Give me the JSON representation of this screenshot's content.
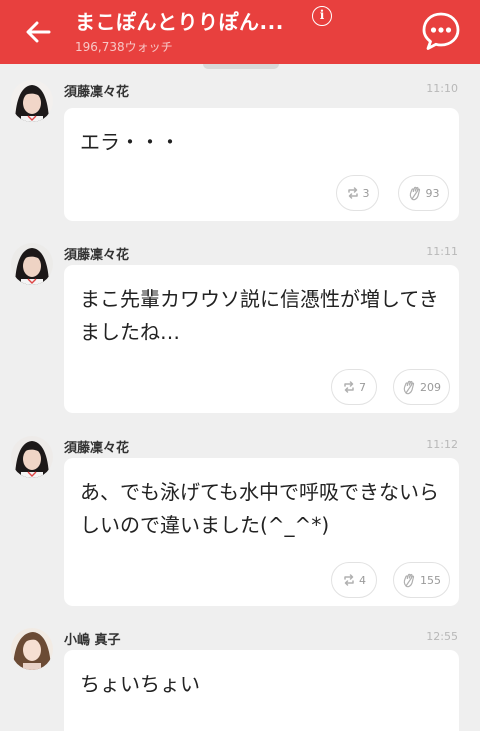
{
  "header": {
    "title": "まこぽんとりりぽん...",
    "watch_count": "196,738ウォッチ",
    "info_glyph": "i",
    "back_icon": "arrow-left-icon",
    "chat_icon": "chat-bubble-icon"
  },
  "colors": {
    "header_bg": "#e8403e",
    "background": "#efefef",
    "card": "#ffffff"
  },
  "posts": [
    {
      "author": "須藤凜々花",
      "time": "11:10",
      "text": "エラ・・・",
      "retalk_count": "3",
      "applause_count": "93"
    },
    {
      "author": "須藤凜々花",
      "time": "11:11",
      "text": "まこ先輩カワウソ説に信憑性が増してきましたね…",
      "retalk_count": "7",
      "applause_count": "209"
    },
    {
      "author": "須藤凜々花",
      "time": "11:12",
      "text": "あ、でも泳げても水中で呼吸できないらしいので違いました(^_^*)",
      "retalk_count": "4",
      "applause_count": "155"
    },
    {
      "author": "小嶋 真子",
      "time": "12:55",
      "text": "ちょいちょい"
    }
  ]
}
